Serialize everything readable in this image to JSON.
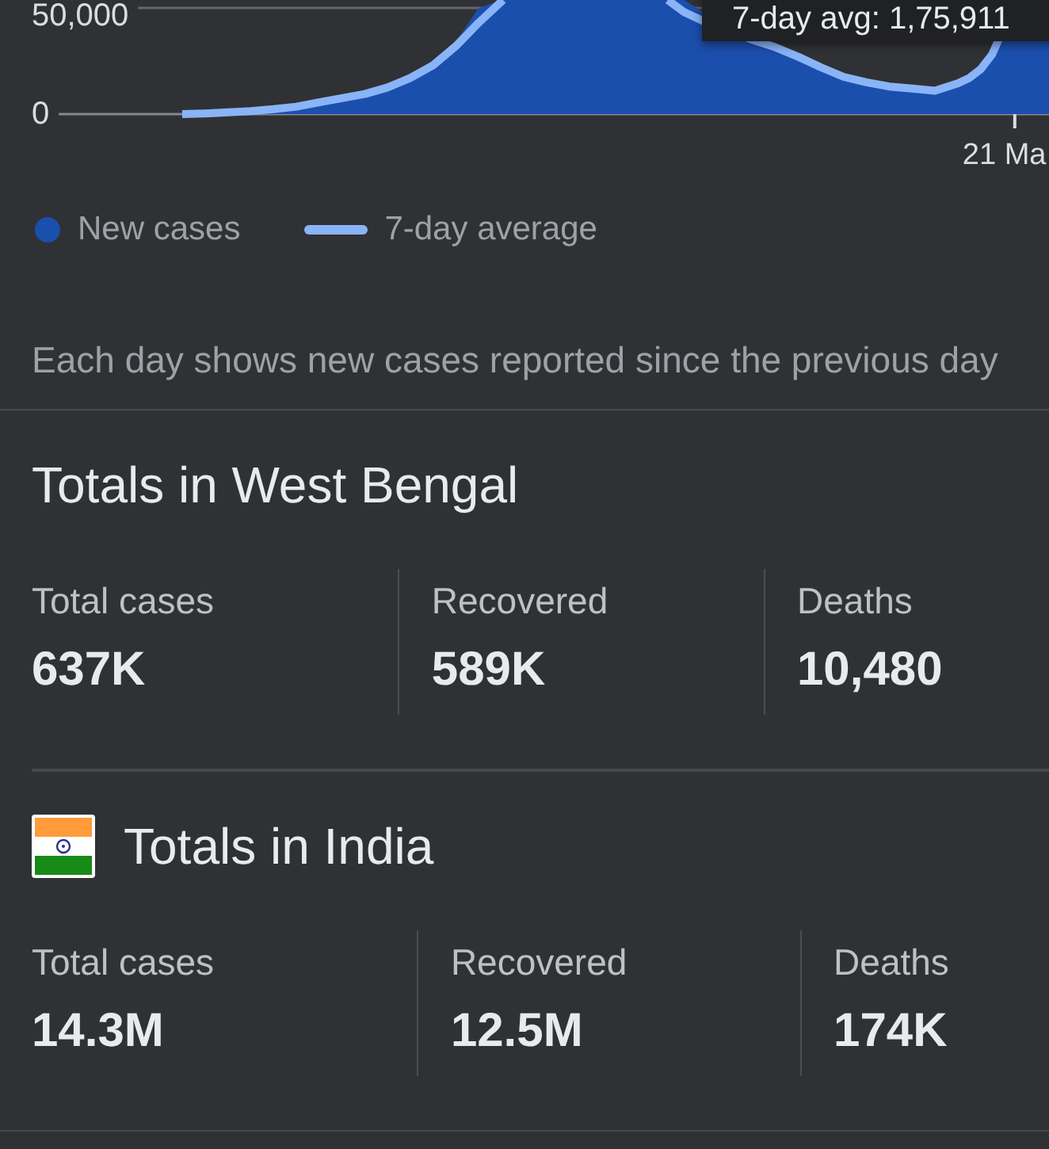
{
  "chart": {
    "y_labels": [
      "50,000",
      "0"
    ],
    "x_label": "21 Ma",
    "tooltip": "7-day avg: 1,75,911",
    "legend": [
      {
        "label": "New cases",
        "kind": "dot",
        "color": "#1b4fae"
      },
      {
        "label": "7-day average",
        "kind": "line",
        "color": "#8ab4f8"
      }
    ],
    "caption": "Each day shows new cases reported since the previous day"
  },
  "sections": [
    {
      "title": "Totals in West Bengal",
      "flag": false,
      "stats": [
        {
          "label": "Total cases",
          "value": "637K"
        },
        {
          "label": "Recovered",
          "value": "589K"
        },
        {
          "label": "Deaths",
          "value": "10,480"
        }
      ]
    },
    {
      "title": "Totals in India",
      "flag": true,
      "stats": [
        {
          "label": "Total cases",
          "value": "14.3M"
        },
        {
          "label": "Recovered",
          "value": "12.5M"
        },
        {
          "label": "Deaths",
          "value": "174K"
        }
      ]
    }
  ]
}
